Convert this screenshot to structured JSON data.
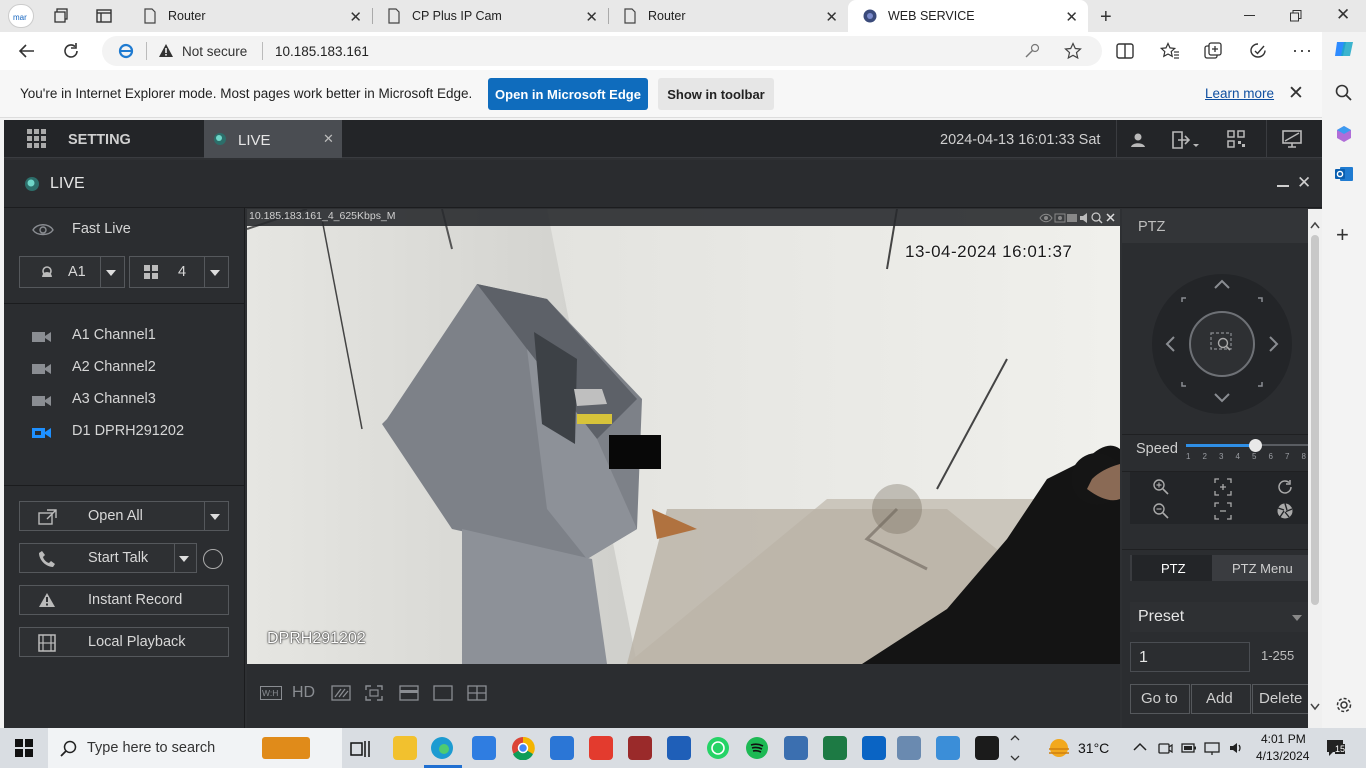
{
  "browser": {
    "tabs": [
      {
        "title": "Router",
        "active": false
      },
      {
        "title": "CP Plus IP Cam",
        "active": false
      },
      {
        "title": "Router",
        "active": false
      },
      {
        "title": "WEB SERVICE",
        "active": true
      }
    ],
    "security_text": "Not secure",
    "url": "10.185.183.161"
  },
  "ie_banner": {
    "message": "You're in Internet Explorer mode. Most pages work better in Microsoft Edge.",
    "open_edge_label": "Open in Microsoft Edge",
    "show_toolbar_label": "Show in toolbar",
    "learn_more_label": "Learn more"
  },
  "app": {
    "setting_label": "SETTING",
    "live_tab_label": "LIVE",
    "datetime": "2024-04-13 16:01:33 Sat",
    "live_title": "LIVE"
  },
  "left_panel": {
    "fast_live_label": "Fast Live",
    "device_select": "A1",
    "layout_select": "4",
    "channels": [
      {
        "label": "A1 Channel1",
        "active": false
      },
      {
        "label": "A2 Channel2",
        "active": false
      },
      {
        "label": "A3 Channel3",
        "active": false
      },
      {
        "label": "D1 DPRH291202",
        "active": true
      }
    ],
    "open_all_label": "Open All",
    "start_talk_label": "Start Talk",
    "instant_record_label": "Instant Record",
    "local_playback_label": "Local Playback"
  },
  "video": {
    "stream_info": "10.185.183.161_4_625Kbps_M",
    "osd_timestamp": "13-04-2024 16:01:37",
    "osd_channel_name": "DPRH291202"
  },
  "video_toolbar": {
    "ratio_label": "W:H",
    "hd_label": "HD"
  },
  "ptz": {
    "title": "PTZ",
    "speed_label": "Speed",
    "speed_ticks": [
      "1",
      "2",
      "3",
      "4",
      "5",
      "6",
      "7",
      "8"
    ],
    "speed_value": 5,
    "tab_ptz": "PTZ",
    "tab_ptz_menu": "PTZ Menu",
    "preset_label": "Preset",
    "preset_value": "1",
    "preset_range": "1-255",
    "goto_label": "Go to",
    "add_label": "Add",
    "delete_label": "Delete"
  },
  "taskbar": {
    "search_placeholder": "Type here to search",
    "weather": "31°C",
    "time": "4:01 PM",
    "date": "4/13/2024",
    "notification_count": "15"
  },
  "colors": {
    "edge_blue": "#0f6cbd",
    "app_dark": "#2b2d30",
    "channel_active": "#1e90ff"
  }
}
